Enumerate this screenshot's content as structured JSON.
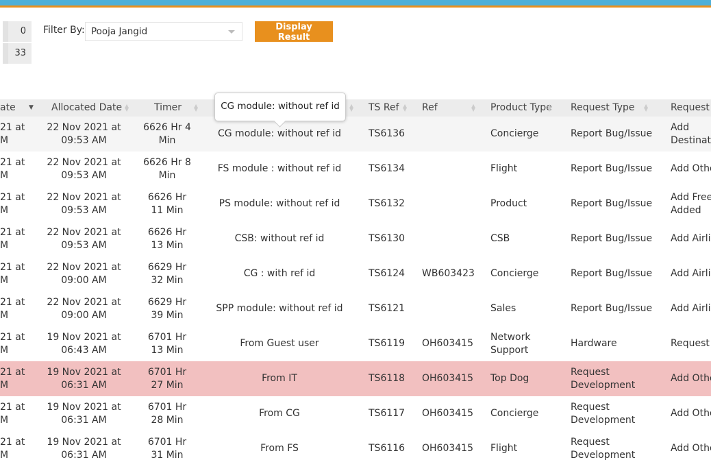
{
  "counts": [
    "0",
    "33"
  ],
  "filter": {
    "label": "Filter By:",
    "value": "Pooja Jangid",
    "button": "Display Result"
  },
  "tooltip": "CG module: without ref id",
  "headers": [
    "ate",
    "Allocated Date",
    "Timer",
    "",
    "TS Ref",
    "Ref",
    "Product Type",
    "Request Type",
    "Request"
  ],
  "colors": {
    "accent": "#e8901e",
    "topbar": "#4fb0d8",
    "highlight": "#f2c0c0"
  },
  "rows": [
    [
      "21 at\nM",
      "22 Nov 2021 at\n09:53 AM",
      "6626 Hr 4\nMin",
      "CG module: without ref id",
      "TS6136",
      "",
      "Concierge",
      "Report Bug/Issue",
      "Add\nDestination"
    ],
    [
      "21 at\nM",
      "22 Nov 2021 at\n09:53 AM",
      "6626 Hr 8\nMin",
      "FS module : without ref id",
      "TS6134",
      "",
      "Flight",
      "Report Bug/Issue",
      "Add Other"
    ],
    [
      "21 at\nM",
      "22 Nov 2021 at\n09:53 AM",
      "6626 Hr\n11 Min",
      "PS module: without ref id",
      "TS6132",
      "",
      "Product",
      "Report Bug/Issue",
      "Add Free\nAdded"
    ],
    [
      "21 at\nM",
      "22 Nov 2021 at\n09:53 AM",
      "6626 Hr\n13 Min",
      "CSB: without ref id",
      "TS6130",
      "",
      "CSB",
      "Report Bug/Issue",
      "Add Airline"
    ],
    [
      "21 at\nM",
      "22 Nov 2021 at\n09:00 AM",
      "6629 Hr\n32 Min",
      "CG : with ref id",
      "TS6124",
      "WB603423",
      "Concierge",
      "Report Bug/Issue",
      "Add Airline"
    ],
    [
      "21 at\nM",
      "22 Nov 2021 at\n09:00 AM",
      "6629 Hr\n39 Min",
      "SPP module: without ref id",
      "TS6121",
      "",
      "Sales",
      "Report Bug/Issue",
      "Add Airline"
    ],
    [
      "21 at\nM",
      "19 Nov 2021 at\n06:43 AM",
      "6701 Hr\n13 Min",
      "From Guest user",
      "TS6119",
      "OH603415",
      "Network\nSupport",
      "Hardware",
      "Request"
    ],
    [
      "21 at\nM",
      "19 Nov 2021 at\n06:31 AM",
      "6701 Hr\n27 Min",
      "From IT",
      "TS6118",
      "OH603415",
      "Top Dog",
      "Request\nDevelopment",
      "Add Other"
    ],
    [
      "21 at\nM",
      "19 Nov 2021 at\n06:31 AM",
      "6701 Hr\n28 Min",
      "From CG",
      "TS6117",
      "OH603415",
      "Concierge",
      "Request\nDevelopment",
      "Add Other"
    ],
    [
      "21 at\nM",
      "19 Nov 2021 at\n06:31 AM",
      "6701 Hr\n31 Min",
      "From FS",
      "TS6116",
      "OH603415",
      "Flight",
      "Request\nDevelopment",
      "Add Other"
    ]
  ]
}
